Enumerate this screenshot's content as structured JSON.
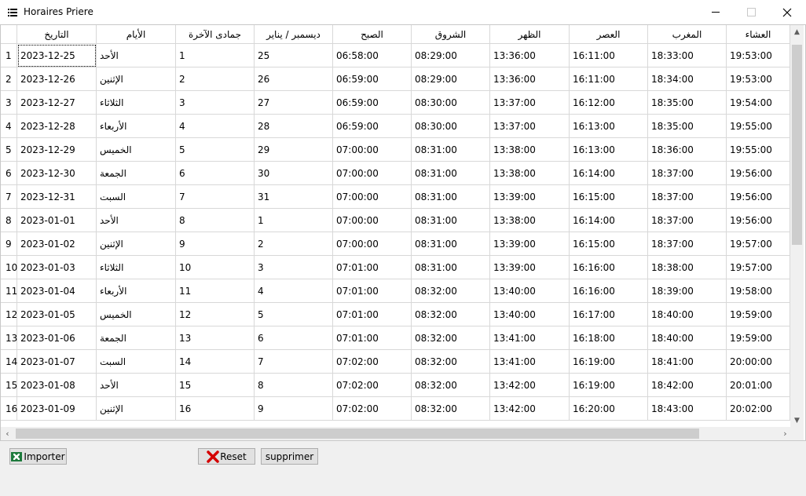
{
  "window": {
    "title": "Horaires Priere",
    "app_icon": "list-icon",
    "controls": [
      "minimize-icon",
      "maximize-icon",
      "close-icon"
    ]
  },
  "table": {
    "headers": [
      "التاريخ",
      "الأيام",
      "جمادى الآخرة",
      "ديسمبر / يناير",
      "الصبح",
      "الشروق",
      "الظهر",
      "العصر",
      "المغرب",
      "العشاء"
    ],
    "rows": [
      {
        "n": "1",
        "cells": [
          "2023-12-25",
          "الأحد",
          "1",
          "25",
          "06:58:00",
          "08:29:00",
          "13:36:00",
          "16:11:00",
          "18:33:00",
          "19:53:00"
        ]
      },
      {
        "n": "2",
        "cells": [
          "2023-12-26",
          "الإثنين",
          "2",
          "26",
          "06:59:00",
          "08:29:00",
          "13:36:00",
          "16:11:00",
          "18:34:00",
          "19:53:00"
        ]
      },
      {
        "n": "3",
        "cells": [
          "2023-12-27",
          "الثلاثاء",
          "3",
          "27",
          "06:59:00",
          "08:30:00",
          "13:37:00",
          "16:12:00",
          "18:35:00",
          "19:54:00"
        ]
      },
      {
        "n": "4",
        "cells": [
          "2023-12-28",
          "الأربعاء",
          "4",
          "28",
          "06:59:00",
          "08:30:00",
          "13:37:00",
          "16:13:00",
          "18:35:00",
          "19:55:00"
        ]
      },
      {
        "n": "5",
        "cells": [
          "2023-12-29",
          "الخميس",
          "5",
          "29",
          "07:00:00",
          "08:31:00",
          "13:38:00",
          "16:13:00",
          "18:36:00",
          "19:55:00"
        ]
      },
      {
        "n": "6",
        "cells": [
          "2023-12-30",
          "الجمعة",
          "6",
          "30",
          "07:00:00",
          "08:31:00",
          "13:38:00",
          "16:14:00",
          "18:37:00",
          "19:56:00"
        ]
      },
      {
        "n": "7",
        "cells": [
          "2023-12-31",
          "السبت",
          "7",
          "31",
          "07:00:00",
          "08:31:00",
          "13:39:00",
          "16:15:00",
          "18:37:00",
          "19:56:00"
        ]
      },
      {
        "n": "8",
        "cells": [
          "2023-01-01",
          "الأحد",
          "8",
          "1",
          "07:00:00",
          "08:31:00",
          "13:38:00",
          "16:14:00",
          "18:37:00",
          "19:56:00"
        ]
      },
      {
        "n": "9",
        "cells": [
          "2023-01-02",
          "الإثنين",
          "9",
          "2",
          "07:00:00",
          "08:31:00",
          "13:39:00",
          "16:15:00",
          "18:37:00",
          "19:57:00"
        ]
      },
      {
        "n": "10",
        "cells": [
          "2023-01-03",
          "الثلاثاء",
          "10",
          "3",
          "07:01:00",
          "08:31:00",
          "13:39:00",
          "16:16:00",
          "18:38:00",
          "19:57:00"
        ]
      },
      {
        "n": "11",
        "cells": [
          "2023-01-04",
          "الأربعاء",
          "11",
          "4",
          "07:01:00",
          "08:32:00",
          "13:40:00",
          "16:16:00",
          "18:39:00",
          "19:58:00"
        ]
      },
      {
        "n": "12",
        "cells": [
          "2023-01-05",
          "الخميس",
          "12",
          "5",
          "07:01:00",
          "08:32:00",
          "13:40:00",
          "16:17:00",
          "18:40:00",
          "19:59:00"
        ]
      },
      {
        "n": "13",
        "cells": [
          "2023-01-06",
          "الجمعة",
          "13",
          "6",
          "07:01:00",
          "08:32:00",
          "13:41:00",
          "16:18:00",
          "18:40:00",
          "19:59:00"
        ]
      },
      {
        "n": "14",
        "cells": [
          "2023-01-07",
          "السبت",
          "14",
          "7",
          "07:02:00",
          "08:32:00",
          "13:41:00",
          "16:19:00",
          "18:41:00",
          "20:00:00"
        ]
      },
      {
        "n": "15",
        "cells": [
          "2023-01-08",
          "الأحد",
          "15",
          "8",
          "07:02:00",
          "08:32:00",
          "13:42:00",
          "16:19:00",
          "18:42:00",
          "20:01:00"
        ]
      },
      {
        "n": "16",
        "cells": [
          "2023-01-09",
          "الإثنين",
          "16",
          "9",
          "07:02:00",
          "08:32:00",
          "13:42:00",
          "16:20:00",
          "18:43:00",
          "20:02:00"
        ]
      }
    ]
  },
  "buttons": {
    "import_label": "Importer",
    "import_icon": "excel-icon",
    "reset_label": "Reset",
    "reset_icon": "red-x-icon",
    "delete_label": "supprimer"
  }
}
